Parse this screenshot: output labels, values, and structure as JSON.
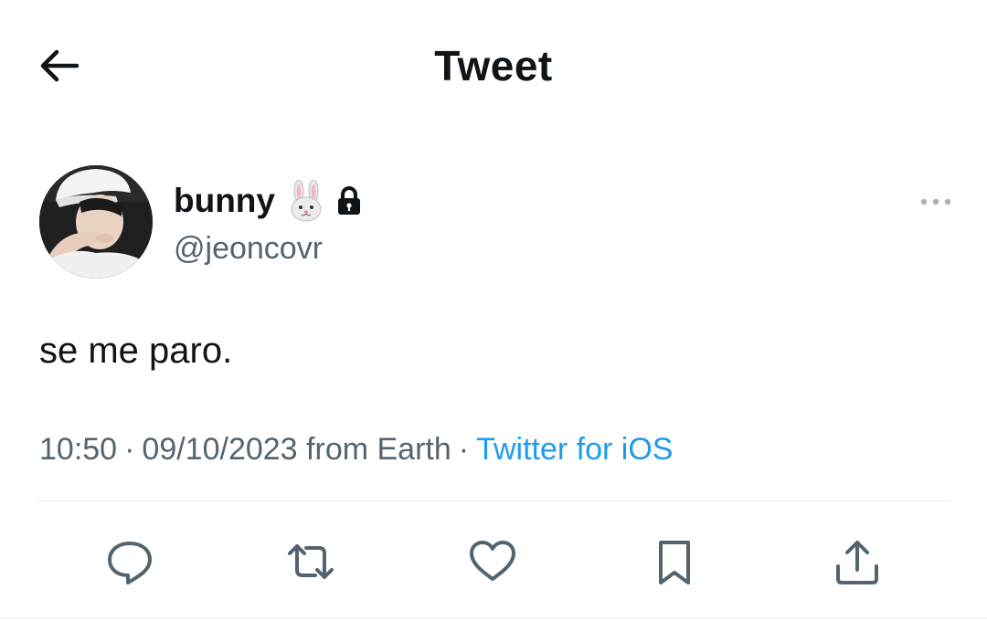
{
  "header": {
    "title": "Tweet",
    "back_icon": "arrow-left-icon"
  },
  "author": {
    "display_name": "bunny",
    "emoji": "🐰",
    "protected_icon": "lock-icon",
    "handle": "@jeoncovr"
  },
  "tweet": {
    "text": "se me paro.",
    "time": "10:50",
    "date": "09/10/2023",
    "location": "from Earth",
    "separator": "·",
    "source": "Twitter for iOS"
  },
  "actions": [
    {
      "name": "reply",
      "icon": "reply-icon"
    },
    {
      "name": "retweet",
      "icon": "retweet-icon"
    },
    {
      "name": "like",
      "icon": "heart-icon"
    },
    {
      "name": "bookmark",
      "icon": "bookmark-icon"
    },
    {
      "name": "share",
      "icon": "share-icon"
    }
  ],
  "colors": {
    "text_primary": "#0f1419",
    "text_secondary": "#536471",
    "link": "#1d9bf0",
    "icon": "#536471",
    "divider": "#e6ecf0"
  }
}
